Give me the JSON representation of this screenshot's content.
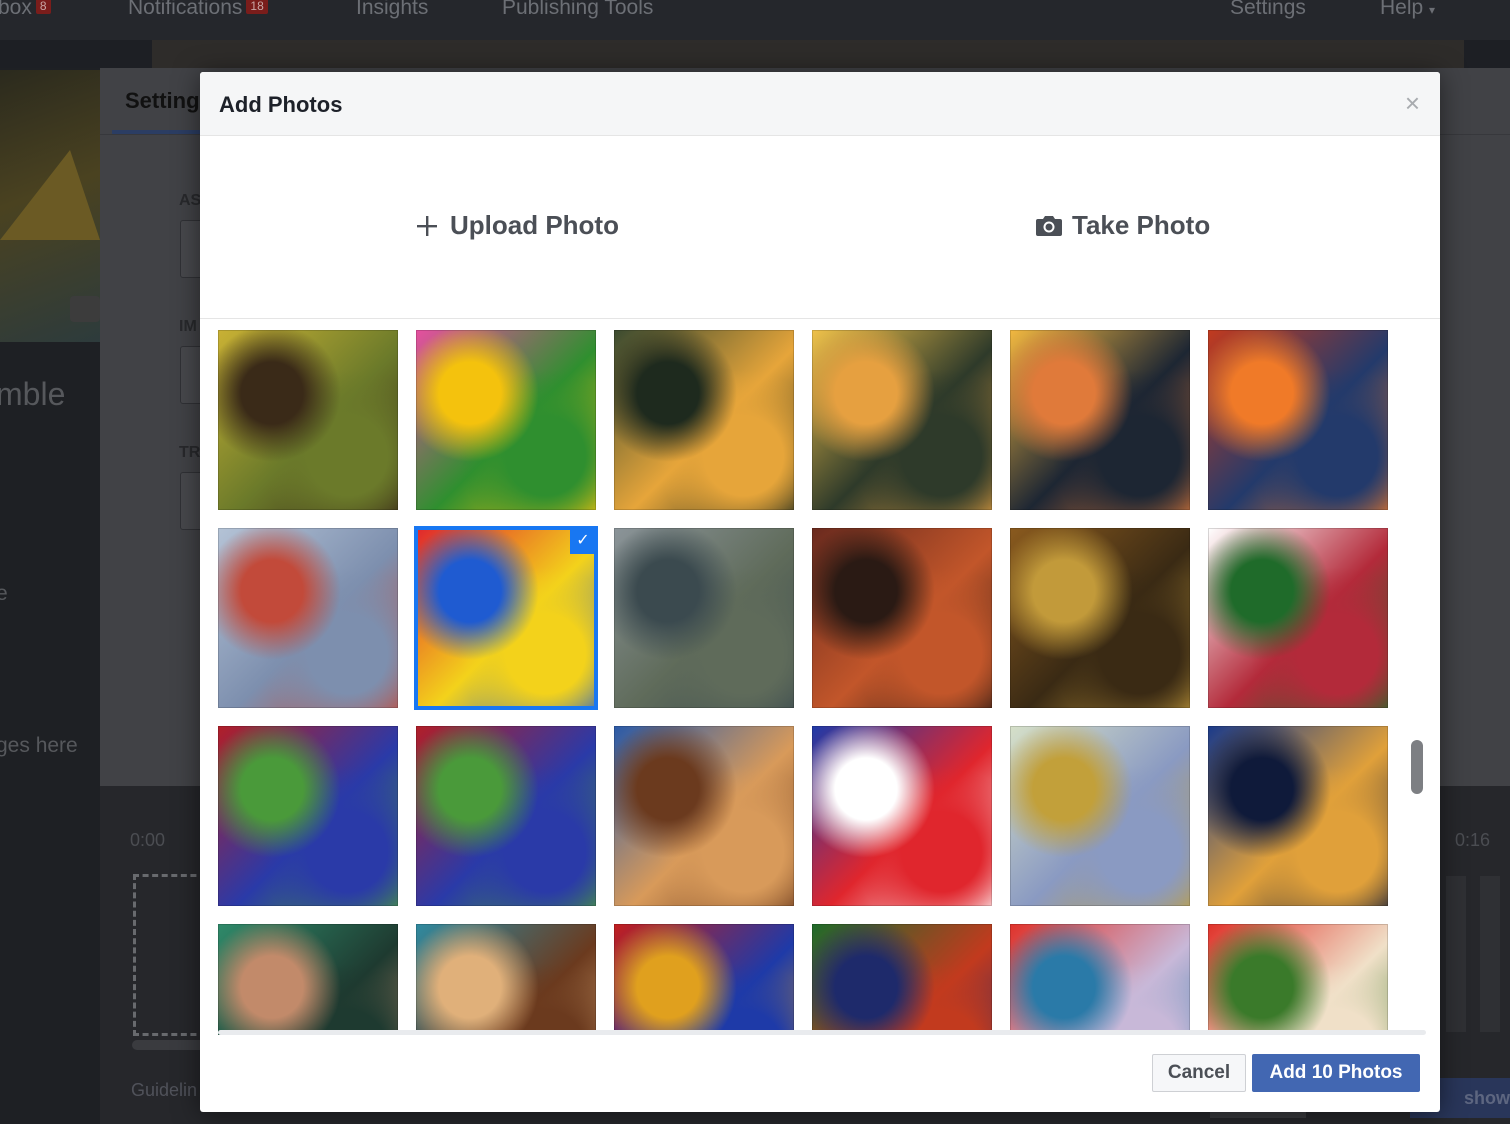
{
  "background": {
    "nav": {
      "inbox": {
        "label": "box",
        "count": "8"
      },
      "notifications": {
        "label": "Notifications",
        "count": "18"
      },
      "insights": "Insights",
      "publishing_tools": "Publishing Tools",
      "settings": "Settings",
      "help": "Help"
    },
    "left_texts": [
      "mble",
      "e",
      "ges here"
    ],
    "panel_tab": "Setting",
    "panel_labels": [
      "AS",
      "IM",
      "TR"
    ],
    "timeline_start": "0:00",
    "timeline_end": "0:16",
    "guidelines": "Guidelin",
    "slideshow_button": "show"
  },
  "modal": {
    "title": "Add Photos",
    "close_label": "×",
    "upload_label": "Upload Photo",
    "take_photo_label": "Take Photo",
    "cancel_label": "Cancel",
    "add_label": "Add 10 Photos"
  },
  "photos": [
    {
      "desc": "yellow face portrait",
      "colors": [
        "#c9b134",
        "#6b7a2a",
        "#3a2a18"
      ],
      "selected": false
    },
    {
      "desc": "colorful abstract face",
      "colors": [
        "#e64fa0",
        "#2f8f2f",
        "#f4c20d"
      ],
      "selected": false
    },
    {
      "desc": "woman green hat closeup",
      "colors": [
        "#3a4a30",
        "#e6a53a",
        "#1e2a1e"
      ],
      "selected": false
    },
    {
      "desc": "woman hat yellow",
      "colors": [
        "#f0c24a",
        "#2e3a2a",
        "#e6a040"
      ],
      "selected": false
    },
    {
      "desc": "woman in black hat",
      "colors": [
        "#f2b840",
        "#1d2633",
        "#e07a3a"
      ],
      "selected": false
    },
    {
      "desc": "red abstract rays",
      "colors": [
        "#c23a1e",
        "#233a6b",
        "#f07a28"
      ],
      "selected": false
    },
    {
      "desc": "children under tree",
      "colors": [
        "#b4c3d6",
        "#7d8fae",
        "#c24a3a"
      ],
      "selected": false
    },
    {
      "desc": "colorful houses",
      "colors": [
        "#e0262d",
        "#f3d21b",
        "#1f5bd1"
      ],
      "selected": true
    },
    {
      "desc": "man at seashore",
      "colors": [
        "#8b9499",
        "#5f6b5a",
        "#3b4a4f"
      ],
      "selected": false
    },
    {
      "desc": "still life fruit",
      "colors": [
        "#6a2a1e",
        "#c2562a",
        "#2a1a14"
      ],
      "selected": false
    },
    {
      "desc": "village painting",
      "colors": [
        "#8a5a1e",
        "#3a2a14",
        "#c29a3a"
      ],
      "selected": false
    },
    {
      "desc": "scribble portrait",
      "colors": [
        "#ffffff",
        "#b32a3a",
        "#1f6b2a"
      ],
      "selected": false
    },
    {
      "desc": "lined portrait red",
      "colors": [
        "#b21e28",
        "#2a3aa8",
        "#4a9a3a"
      ],
      "selected": false
    },
    {
      "desc": "lined portrait red copy",
      "colors": [
        "#b21e28",
        "#2a3aa8",
        "#4a9a3a"
      ],
      "selected": false
    },
    {
      "desc": "woman sunglasses",
      "colors": [
        "#2a5aa8",
        "#d89a5a",
        "#6b3a1e"
      ],
      "selected": false
    },
    {
      "desc": "colorful pattern",
      "colors": [
        "#1f3aa8",
        "#e0262d",
        "#ffffff"
      ],
      "selected": false
    },
    {
      "desc": "birch trees",
      "colors": [
        "#d6e0c8",
        "#8a9ac2",
        "#c2a03a"
      ],
      "selected": false
    },
    {
      "desc": "blue houses",
      "colors": [
        "#1a3a8a",
        "#e0a03a",
        "#0f1a3a"
      ],
      "selected": false
    },
    {
      "desc": "woman green hat",
      "colors": [
        "#2f8a6a",
        "#1e3a30",
        "#c28a6a"
      ],
      "selected": false
    },
    {
      "desc": "woman brown hair",
      "colors": [
        "#2f8aa0",
        "#6b3a1e",
        "#e0b07a"
      ],
      "selected": false
    },
    {
      "desc": "abstract shapes",
      "colors": [
        "#c21e1e",
        "#1e3aa8",
        "#e0a01e"
      ],
      "selected": false
    },
    {
      "desc": "abstract towers",
      "colors": [
        "#1e6b2a",
        "#c23a1e",
        "#1e2a6b"
      ],
      "selected": false
    },
    {
      "desc": "red roof houses",
      "colors": [
        "#e0322a",
        "#c8b8d8",
        "#2a7aa8"
      ],
      "selected": false
    },
    {
      "desc": "white house red roof",
      "colors": [
        "#e0322a",
        "#f0e0c8",
        "#3a7a2a"
      ],
      "selected": false
    }
  ]
}
